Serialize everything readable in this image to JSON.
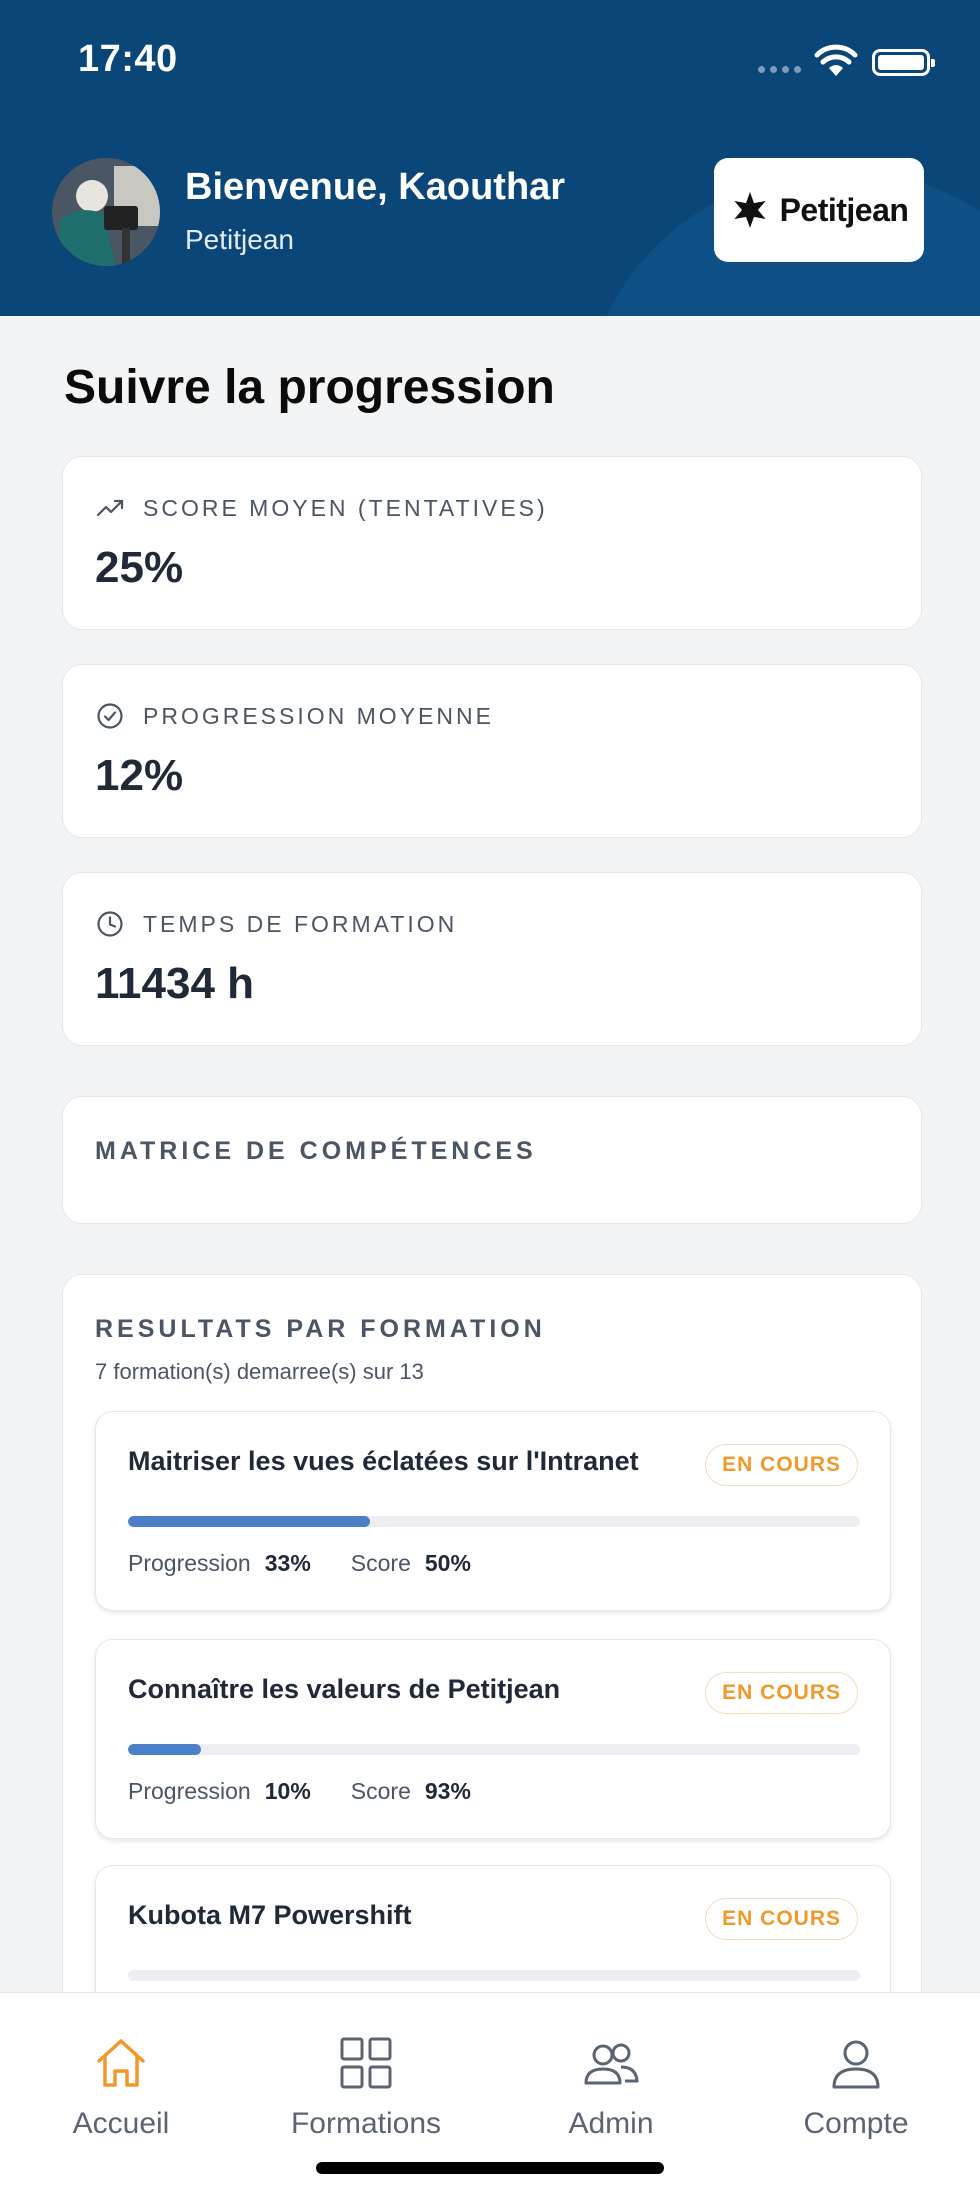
{
  "status_bar": {
    "time": "17:40"
  },
  "header": {
    "welcome": "Bienvenue, Kaouthar",
    "company": "Petitjean",
    "logo_text": "Petitjean"
  },
  "main": {
    "title": "Suivre la progression",
    "stats": [
      {
        "label": "SCORE MOYEN (TENTATIVES)",
        "value": "25%",
        "icon": "trending-up-icon"
      },
      {
        "label": "PROGRESSION MOYENNE",
        "value": "12%",
        "icon": "check-circle-icon"
      },
      {
        "label": "TEMPS DE FORMATION",
        "value": "11434 h",
        "icon": "clock-icon"
      }
    ],
    "matrix_title": "MATRICE DE COMPÉTENCES",
    "results": {
      "title": "RESULTATS PAR FORMATION",
      "subtitle": "7 formation(s) demarree(s) sur 13",
      "progress_label": "Progression",
      "score_label": "Score",
      "courses": [
        {
          "title": "Maitriser les vues éclatées sur l'Intranet",
          "status": "EN COURS",
          "progress": "33%",
          "progress_value": 33,
          "score": "50%"
        },
        {
          "title": "Connaître les valeurs de Petitjean",
          "status": "EN COURS",
          "progress": "10%",
          "progress_value": 10,
          "score": "93%"
        },
        {
          "title": "Kubota M7 Powershift",
          "status": "EN COURS",
          "progress_value": 0
        }
      ]
    }
  },
  "bottom_nav": {
    "items": [
      {
        "label": "Accueil",
        "icon": "home-icon",
        "active": true
      },
      {
        "label": "Formations",
        "icon": "grid-icon",
        "active": false
      },
      {
        "label": "Admin",
        "icon": "users-icon",
        "active": false
      },
      {
        "label": "Compte",
        "icon": "user-icon",
        "active": false
      }
    ]
  },
  "colors": {
    "header_bg": "#0b4679",
    "accent_orange": "#f0982a",
    "progress_blue": "#4b80c8"
  }
}
